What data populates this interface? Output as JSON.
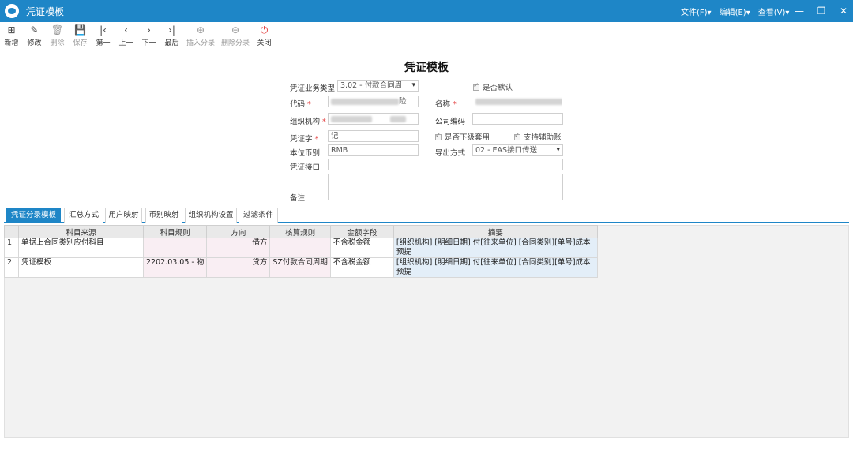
{
  "window": {
    "title": "凭证模板",
    "menus": [
      "文件(F)▾",
      "编辑(E)▾",
      "查看(V)▾"
    ],
    "controls": [
      "—",
      "❐",
      "✕"
    ]
  },
  "toolbar": [
    {
      "label": "新增",
      "icon": "new-icon",
      "glyph": "⊞",
      "enabled": true
    },
    {
      "label": "修改",
      "icon": "edit-icon",
      "glyph": "✎",
      "enabled": true
    },
    {
      "label": "删除",
      "icon": "delete-icon",
      "glyph": "🗑",
      "enabled": false
    },
    {
      "label": "保存",
      "icon": "save-icon",
      "glyph": "💾",
      "enabled": false
    },
    {
      "label": "第一",
      "icon": "first-icon",
      "glyph": "|‹",
      "enabled": true
    },
    {
      "label": "上一",
      "icon": "prev-icon",
      "glyph": "‹",
      "enabled": true
    },
    {
      "label": "下一",
      "icon": "next-icon",
      "glyph": "›",
      "enabled": true
    },
    {
      "label": "最后",
      "icon": "last-icon",
      "glyph": "›|",
      "enabled": true
    },
    {
      "label": "插入分录",
      "icon": "insert-entry-icon",
      "glyph": "⊕",
      "enabled": false
    },
    {
      "label": "删除分录",
      "icon": "delete-entry-icon",
      "glyph": "⊖",
      "enabled": false
    },
    {
      "label": "关闭",
      "icon": "power-icon",
      "glyph": "⏻",
      "enabled": true
    }
  ],
  "page_title": "凭证模板",
  "form": {
    "business_type_label": "凭证业务类型",
    "business_type_value": "3.02 - 付款合同周",
    "is_default_label": "是否默认",
    "code_label": "代码",
    "code_value_suffix": "险",
    "name_label": "名称",
    "org_label": "组织机构",
    "company_code_label": "公司编码",
    "voucher_word_label": "凭证字",
    "voucher_word_value": "记",
    "subordinate_label": "是否下级套用",
    "aux_label": "支持辅助账",
    "currency_label": "本位币别",
    "currency_value": "RMB",
    "export_label": "导出方式",
    "export_value": "02 - EAS接口传送",
    "interface_label": "凭证接口",
    "remark_label": "备注"
  },
  "tabs": [
    "凭证分录模板",
    "汇总方式",
    "用户映射",
    "币别映射",
    "组织机构设置",
    "过滤条件"
  ],
  "grid": {
    "columns": [
      "",
      "科目来源",
      "科目规则",
      "方向",
      "核算规则",
      "金额字段",
      "摘要"
    ],
    "rows": [
      {
        "no": "1",
        "source": "单据上合同类别应付科目",
        "rule": "",
        "direction": "借方",
        "calc": "",
        "amount": "不含税金额",
        "summary": "[组织机构] [明细日期] 付[往来单位] [合同类别][单号]成本预提"
      },
      {
        "no": "2",
        "source": "凭证模板",
        "rule": "2202.03.05 - 物",
        "direction": "贷方",
        "calc": "SZ付款合同周期",
        "amount": "不含税金额",
        "summary": "[组织机构] [明细日期] 付[往来单位] [合同类别][单号]成本预提"
      }
    ]
  }
}
